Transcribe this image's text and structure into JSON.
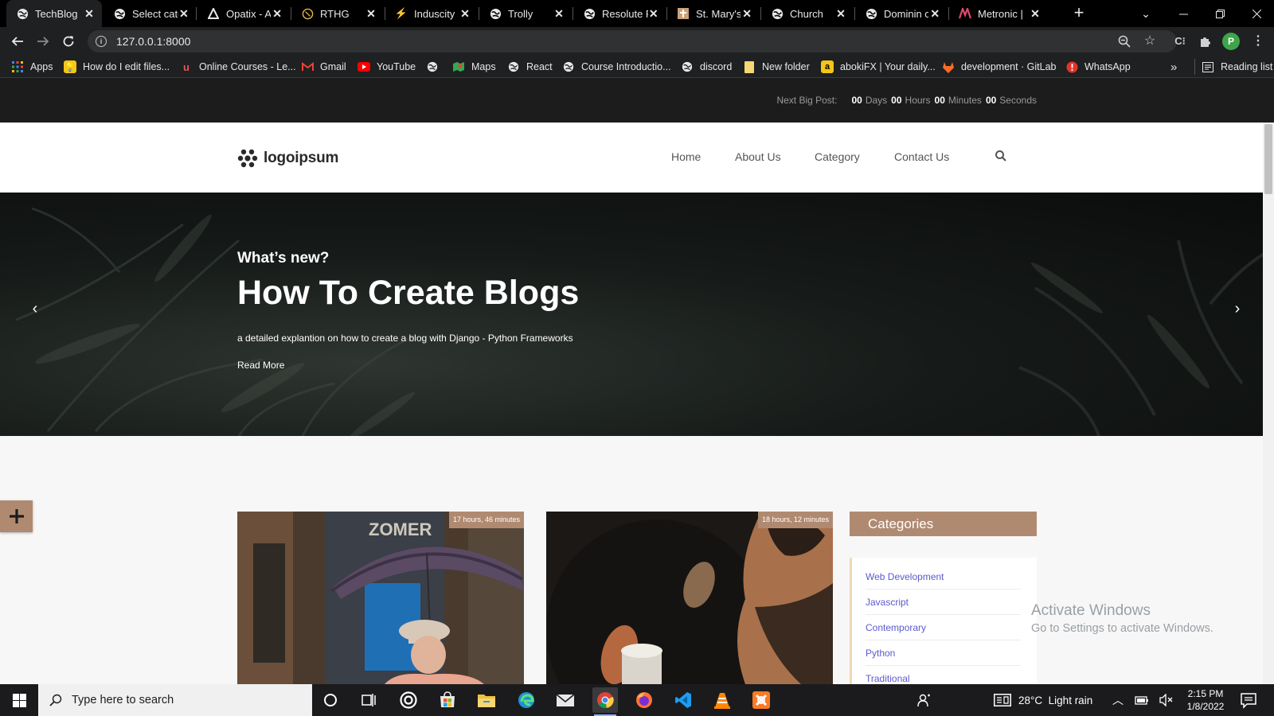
{
  "browser": {
    "tabs": [
      {
        "title": "TechBlog",
        "icon": "globe-icon",
        "active": true
      },
      {
        "title": "Select cate",
        "icon": "globe-icon"
      },
      {
        "title": "Opatix - A",
        "icon": "opatix-icon"
      },
      {
        "title": "RTHG",
        "icon": "rthg-icon"
      },
      {
        "title": "Induscity",
        "icon": "bolt-icon"
      },
      {
        "title": "Trolly",
        "icon": "globe-icon"
      },
      {
        "title": "Resolute P",
        "icon": "globe-icon"
      },
      {
        "title": "St. Mary's",
        "icon": "cross-icon"
      },
      {
        "title": "Church",
        "icon": "globe-icon"
      },
      {
        "title": "Dominin c",
        "icon": "globe-icon"
      },
      {
        "title": "Metronic |",
        "icon": "metronic-icon"
      }
    ],
    "url": "127.0.0.1:8000",
    "profile_initial": "P",
    "bookmarks": [
      {
        "label": "Apps",
        "icon": "apps-grid-icon"
      },
      {
        "label": "How do I edit files...",
        "icon": "bulb-icon"
      },
      {
        "label": "Online Courses - Le...",
        "icon": "udemy-icon"
      },
      {
        "label": "Gmail",
        "icon": "gmail-icon"
      },
      {
        "label": "YouTube",
        "icon": "youtube-icon"
      },
      {
        "label": "",
        "icon": "globe-icon"
      },
      {
        "label": "Maps",
        "icon": "maps-icon"
      },
      {
        "label": "React",
        "icon": "globe-icon"
      },
      {
        "label": "Course Introductio...",
        "icon": "globe-icon"
      },
      {
        "label": "discord",
        "icon": "globe-icon"
      },
      {
        "label": "New folder",
        "icon": "folder-icon"
      },
      {
        "label": "abokiFX | Your daily...",
        "icon": "aboki-icon"
      },
      {
        "label": "development · GitLab",
        "icon": "gitlab-icon"
      },
      {
        "label": "WhatsApp",
        "icon": "whatsapp-icon"
      }
    ],
    "bookmarks_more": "»",
    "reading_list": "Reading list"
  },
  "site": {
    "countdown": {
      "label": "Next Big Post:",
      "days": "00",
      "days_unit": "Days",
      "hours": "00",
      "hours_unit": "Hours",
      "minutes": "00",
      "minutes_unit": "Minutes",
      "seconds": "00",
      "seconds_unit": "Seconds"
    },
    "logo_text": "logoipsum",
    "nav": [
      "Home",
      "About Us",
      "Category",
      "Contact Us"
    ],
    "hero": {
      "kicker": "What’s new?",
      "title": "How To Create Blogs",
      "description": "a detailed explantion on how to create a blog with Django - Python Frameworks",
      "read_more": "Read More",
      "prev": "‹",
      "next": "›"
    },
    "posts": [
      {
        "time": "17 hours, 46 minutes"
      },
      {
        "time": "18 hours, 12 minutes"
      }
    ],
    "categories": {
      "heading": "Categories",
      "items": [
        "Web Development",
        "Javascript",
        "Contemporary",
        "Python",
        "Traditional"
      ]
    }
  },
  "watermark": {
    "line1": "Activate Windows",
    "line2": "Go to Settings to activate Windows."
  },
  "taskbar": {
    "search_placeholder": "Type here to search",
    "weather": "28°C  Light rain",
    "time": "2:15 PM",
    "date": "1/8/2022"
  },
  "colors": {
    "accent": "#b08a70",
    "link": "#5a5acf",
    "topbar": "#1c1c1c"
  }
}
